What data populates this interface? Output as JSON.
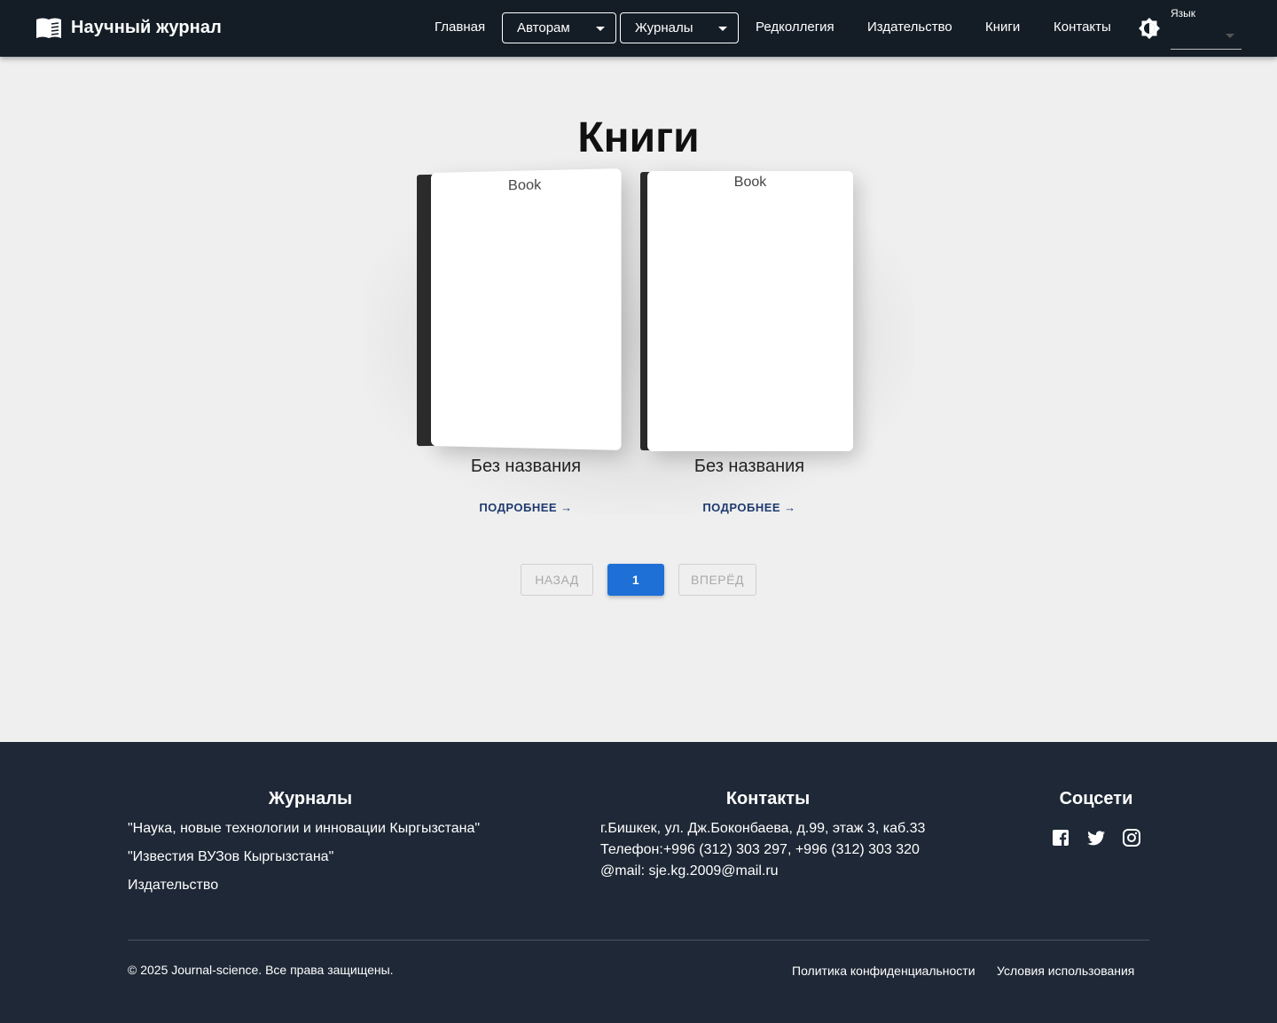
{
  "header": {
    "brand": "Научный журнал",
    "nav": {
      "home": "Главная",
      "authors": "Авторам",
      "journals": "Журналы",
      "editorial": "Редколлегия",
      "publisher": "Издательство",
      "books": "Книги",
      "contacts": "Контакты"
    },
    "language_label": "Язык",
    "language_value": ""
  },
  "main": {
    "title": "Книги",
    "books": [
      {
        "image_alt": "Book",
        "title": "Без названия",
        "more": "ПОДРОБНЕЕ →"
      },
      {
        "image_alt": "Book",
        "title": "Без названия",
        "more": "ПОДРОБНЕЕ →"
      }
    ],
    "pagination": {
      "prev": "НАЗАД",
      "current": "1",
      "next": "ВПЕРЁД"
    }
  },
  "footer": {
    "journals_heading": "Журналы",
    "journals": [
      "\"Наука, новые технологии и инновации Кыргызстана\"",
      "\"Известия ВУЗов Кыргызстана\"",
      "Издательство"
    ],
    "contacts_heading": "Контакты",
    "contacts": [
      "г.Бишкек, ул. Дж.Боконбаева, д.99, этаж 3, каб.33",
      "Телефон:+996 (312) 303 297, +996 (312) 303 320",
      "@mail: sje.kg.2009@mail.ru"
    ],
    "social_heading": "Соцсети",
    "social_icons": [
      "facebook-icon",
      "twitter-icon",
      "instagram-icon"
    ],
    "copyright": "© 2025 Journal-science. Все права защищены.",
    "privacy": "Политика конфиденциальности",
    "terms": "Условия использования"
  },
  "colors": {
    "header_bg": "#141d26",
    "footer_bg": "#1e2836",
    "page_bg": "#efefef",
    "accent": "#1e6fd6",
    "link": "#1e3a6e"
  }
}
